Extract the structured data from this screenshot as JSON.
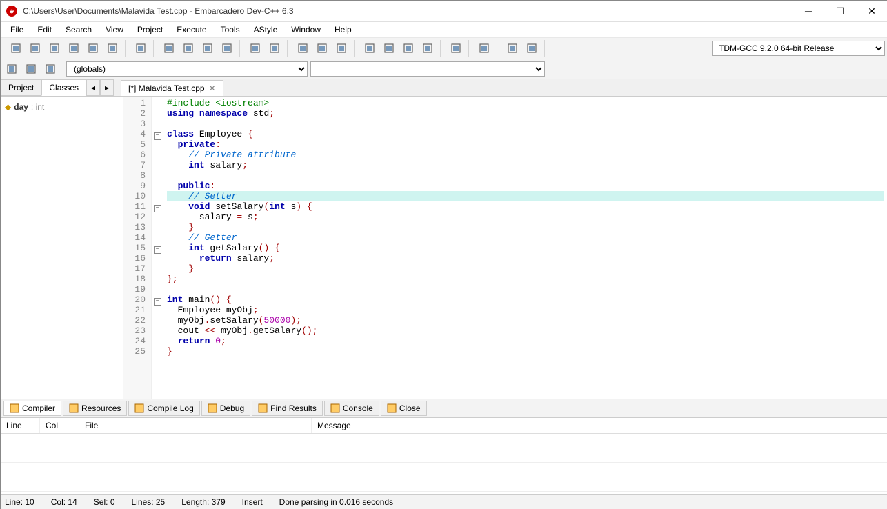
{
  "title": "C:\\Users\\User\\Documents\\Malavida Test.cpp - Embarcadero Dev-C++ 6.3",
  "menu": [
    "File",
    "Edit",
    "Search",
    "View",
    "Project",
    "Execute",
    "Tools",
    "AStyle",
    "Window",
    "Help"
  ],
  "compiler_select": "TDM-GCC 9.2.0 64-bit Release",
  "scope_dd": "(globals)",
  "left_tabs": [
    "Project",
    "Classes"
  ],
  "left_active": "Classes",
  "tree": {
    "var": "day",
    "type": ": int"
  },
  "ed_tab": "[*] Malavida Test.cpp",
  "lines": [
    {
      "n": 1,
      "fold": "",
      "html": "<span class='pp'>#include &lt;iostream&gt;</span>"
    },
    {
      "n": 2,
      "fold": "",
      "html": "<span class='kw'>using</span> <span class='kw'>namespace</span> std<span class='op'>;</span>"
    },
    {
      "n": 3,
      "fold": "",
      "html": ""
    },
    {
      "n": 4,
      "fold": "-",
      "html": "<span class='kw'>class</span> Employee <span class='op'>{</span>"
    },
    {
      "n": 5,
      "fold": "",
      "html": "  <span class='kw'>private</span><span class='op'>:</span>"
    },
    {
      "n": 6,
      "fold": "",
      "html": "    <span class='cm'>// Private attribute</span>"
    },
    {
      "n": 7,
      "fold": "",
      "html": "    <span class='ty'>int</span> salary<span class='op'>;</span>"
    },
    {
      "n": 8,
      "fold": "",
      "html": ""
    },
    {
      "n": 9,
      "fold": "",
      "html": "  <span class='kw'>public</span><span class='op'>:</span>"
    },
    {
      "n": 10,
      "fold": "",
      "hl": true,
      "html": "    <span class='cm'>// Setter</span>"
    },
    {
      "n": 11,
      "fold": "-",
      "html": "    <span class='ty'>void</span> setSalary<span class='op'>(</span><span class='ty'>int</span> s<span class='op'>)</span> <span class='op'>{</span>"
    },
    {
      "n": 12,
      "fold": "",
      "html": "      salary <span class='op'>=</span> s<span class='op'>;</span>"
    },
    {
      "n": 13,
      "fold": "",
      "html": "    <span class='op'>}</span>"
    },
    {
      "n": 14,
      "fold": "",
      "html": "    <span class='cm'>// Getter</span>"
    },
    {
      "n": 15,
      "fold": "-",
      "html": "    <span class='ty'>int</span> getSalary<span class='op'>()</span> <span class='op'>{</span>"
    },
    {
      "n": 16,
      "fold": "",
      "html": "      <span class='kw'>return</span> salary<span class='op'>;</span>"
    },
    {
      "n": 17,
      "fold": "",
      "html": "    <span class='op'>}</span>"
    },
    {
      "n": 18,
      "fold": "",
      "html": "<span class='op'>};</span>"
    },
    {
      "n": 19,
      "fold": "",
      "html": ""
    },
    {
      "n": 20,
      "fold": "-",
      "html": "<span class='ty'>int</span> main<span class='op'>()</span> <span class='op'>{</span>"
    },
    {
      "n": 21,
      "fold": "",
      "html": "  Employee myObj<span class='op'>;</span>"
    },
    {
      "n": 22,
      "fold": "",
      "html": "  myObj<span class='op'>.</span>setSalary<span class='op'>(</span><span class='num'>50000</span><span class='op'>);</span>"
    },
    {
      "n": 23,
      "fold": "",
      "html": "  cout <span class='op'>&lt;&lt;</span> myObj<span class='op'>.</span>getSalary<span class='op'>();</span>"
    },
    {
      "n": 24,
      "fold": "",
      "html": "  <span class='kw'>return</span> <span class='num'>0</span><span class='op'>;</span>"
    },
    {
      "n": 25,
      "fold": "",
      "html": "<span class='op'>}</span>"
    }
  ],
  "bottom_tabs": [
    {
      "label": "Compiler",
      "icon": "shield-icon"
    },
    {
      "label": "Resources",
      "icon": "file-icon"
    },
    {
      "label": "Compile Log",
      "icon": "log-icon"
    },
    {
      "label": "Debug",
      "icon": "bug-icon"
    },
    {
      "label": "Find Results",
      "icon": "search-icon"
    },
    {
      "label": "Console",
      "icon": "console-icon"
    },
    {
      "label": "Close",
      "icon": "save-icon"
    }
  ],
  "bottom_active": "Compiler",
  "bot_headers": [
    "Line",
    "Col",
    "File",
    "Message"
  ],
  "status": {
    "line": "Line:",
    "line_v": "10",
    "col": "Col:",
    "col_v": "14",
    "sel": "Sel:",
    "sel_v": "0",
    "lines": "Lines:",
    "lines_v": "25",
    "len": "Length:",
    "len_v": "379",
    "mode": "Insert",
    "msg": "Done parsing in 0.016 seconds"
  },
  "toolbar_icons": [
    [
      "new-file",
      "open-file",
      "save-file",
      "save-all",
      "close-file",
      "close-all"
    ],
    [
      "print"
    ],
    [
      "find",
      "replace",
      "find-in-files",
      "bookmark"
    ],
    [
      "undo",
      "redo"
    ],
    [
      "compile",
      "run",
      "compile-run"
    ],
    [
      "grid1",
      "grid2",
      "grid3",
      "grid4"
    ],
    [
      "check"
    ],
    [
      "stop"
    ],
    [
      "chart1",
      "chart2"
    ]
  ],
  "toolbar2_icons": [
    "back",
    "forward",
    "bookmark2"
  ]
}
